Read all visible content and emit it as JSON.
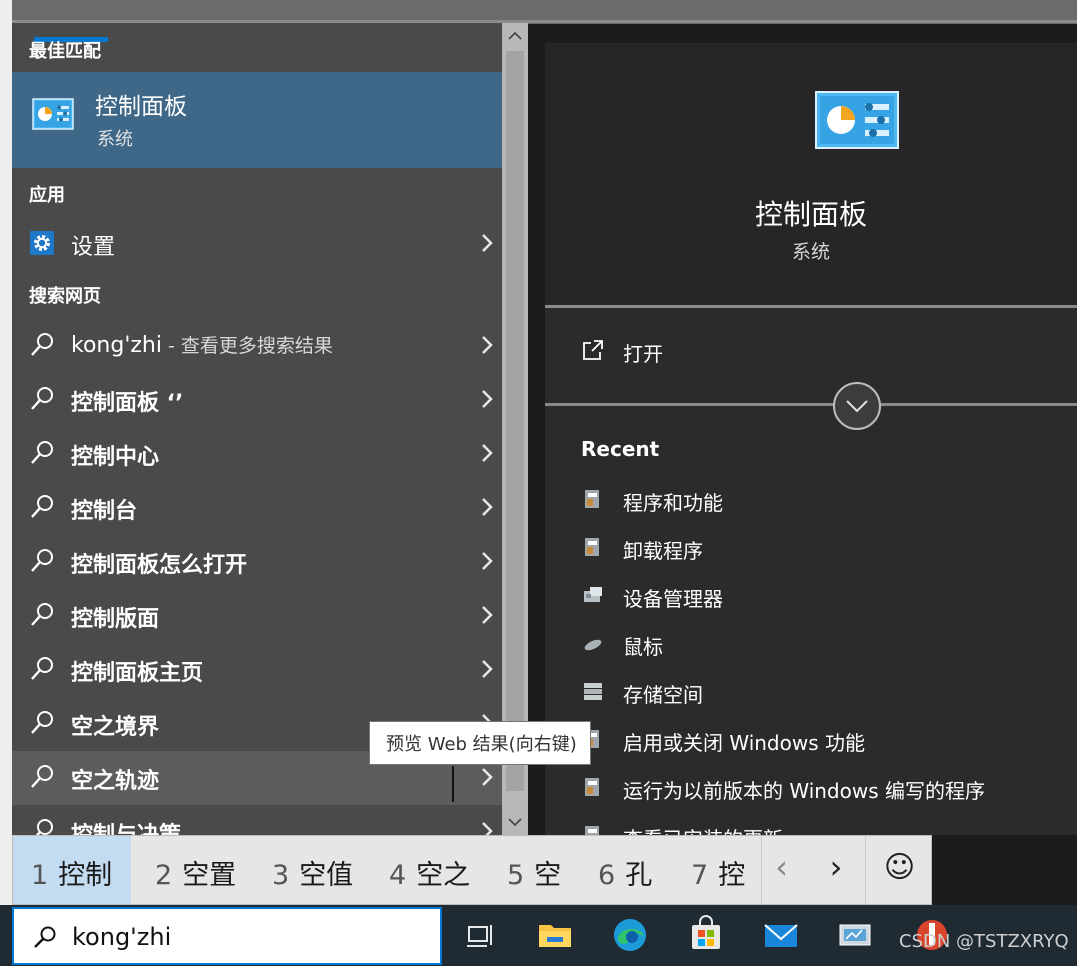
{
  "search": {
    "value": "kong'zhi"
  },
  "left": {
    "best_match_title": "最佳匹配",
    "best_match": {
      "title": "控制面板",
      "subtitle": "系统"
    },
    "apps_title": "应用",
    "apps": [
      {
        "label": "设置"
      }
    ],
    "web_title": "搜索网页",
    "web_first": {
      "label": "kong'zhi",
      "suffix": " - 查看更多搜索结果"
    },
    "web_items": [
      {
        "label": "控制面板 ‘’"
      },
      {
        "label": "控制中心"
      },
      {
        "label": "控制台"
      },
      {
        "label": "控制面板怎么打开"
      },
      {
        "label": "控制版面"
      },
      {
        "label": "控制面板主页"
      },
      {
        "label": "空之境界"
      },
      {
        "label": "空之轨迹"
      },
      {
        "label": "控制与决策"
      }
    ],
    "tooltip": "预览 Web 结果(向右键)"
  },
  "right": {
    "title": "控制面板",
    "subtitle": "系统",
    "open_label": "打开",
    "recent_title": "Recent",
    "recent": [
      {
        "label": "程序和功能",
        "icon": "programs-icon"
      },
      {
        "label": "卸载程序",
        "icon": "programs-icon"
      },
      {
        "label": "设备管理器",
        "icon": "device-manager-icon"
      },
      {
        "label": "鼠标",
        "icon": "mouse-icon"
      },
      {
        "label": "存储空间",
        "icon": "storage-icon"
      },
      {
        "label": "启用或关闭 Windows 功能",
        "icon": "programs-icon"
      },
      {
        "label": "运行为以前版本的 Windows 编写的程序",
        "icon": "programs-icon"
      },
      {
        "label": "查看已安装的更新",
        "icon": "programs-icon"
      }
    ]
  },
  "ime": {
    "candidates": [
      {
        "num": "1",
        "text": "控制"
      },
      {
        "num": "2",
        "text": "空置"
      },
      {
        "num": "3",
        "text": "空值"
      },
      {
        "num": "4",
        "text": "空之"
      },
      {
        "num": "5",
        "text": "空"
      },
      {
        "num": "6",
        "text": "孔"
      },
      {
        "num": "7",
        "text": "控"
      }
    ],
    "prev": "‹",
    "next": "›",
    "emoji": "☺"
  },
  "watermark": "CSDN @TSTZXRYQ",
  "colors": {
    "accent": "#0078d4",
    "selected_result": "#3f6888",
    "left_panel": "#4a4a4a",
    "right_panel": "#2b2b2b",
    "ime_selected": "#c4dcf2"
  }
}
